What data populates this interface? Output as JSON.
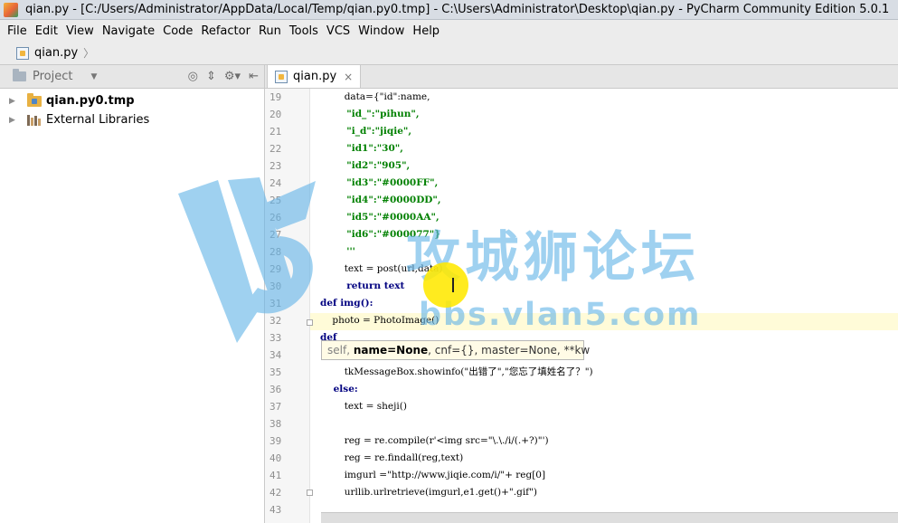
{
  "window": {
    "title": "qian.py - [C:/Users/Administrator/AppData/Local/Temp/qian.py0.tmp] - C:\\Users\\Administrator\\Desktop\\qian.py - PyCharm Community Edition 5.0.1"
  },
  "menu": {
    "items": [
      "File",
      "Edit",
      "View",
      "Navigate",
      "Code",
      "Refactor",
      "Run",
      "Tools",
      "VCS",
      "Window",
      "Help"
    ]
  },
  "breadcrumb": {
    "file": "qian.py",
    "arrow": "〉"
  },
  "project_panel": {
    "title": "Project",
    "tree": [
      {
        "label": "qian.py0.tmp",
        "selected": true
      },
      {
        "label": "External Libraries",
        "selected": false
      }
    ]
  },
  "editor": {
    "tab": {
      "label": "qian.py",
      "close": "×"
    },
    "line_numbers": [
      "19",
      "20",
      "21",
      "22",
      "23",
      "24",
      "25",
      "26",
      "27",
      "28",
      "29",
      "30",
      "31",
      "32",
      "33",
      "34",
      "35",
      "36",
      "37",
      "38",
      "39",
      "40",
      "41",
      "42",
      "43"
    ],
    "lines": [
      "        data={\"id\":name,",
      "        \"id_\":\"pihun\",",
      "        \"i_d\":\"jiqie\",",
      "        \"id1\":\"30\",",
      "        \"id2\":\"905\",",
      "        \"id3\":\"#0000FF\",",
      "        \"id4\":\"#0000DD\",",
      "        \"id5\":\"#0000AA\",",
      "        \"id6\":\"#000077\"}",
      "        '''",
      "        text = post(url,data)",
      "        return text",
      "def img():",
      "    photo = PhotoImage()",
      "def ",
      "",
      "        tkMessageBox.showinfo(\"出错了\",\"您忘了填姓名了？\")",
      "    else:",
      "        text = sheji()",
      "",
      "        reg = re.compile(r'<img src=\"\\.\\./i/(.+?)\"')",
      "        reg = re.findall(reg,text)",
      "        imgurl =\"http://www.jiqie.com/i/\"+ reg[0]",
      "        urllib.urlretrieve(imgurl,e1.get()+\".gif\")",
      ""
    ]
  },
  "tooltip": {
    "param_self": "self,",
    "param_name": "name=None",
    "rest": ", cnf={}, master=None, **kw"
  },
  "watermark": {
    "title": "攻城狮论坛",
    "url": "bbs.vlan5.com"
  }
}
